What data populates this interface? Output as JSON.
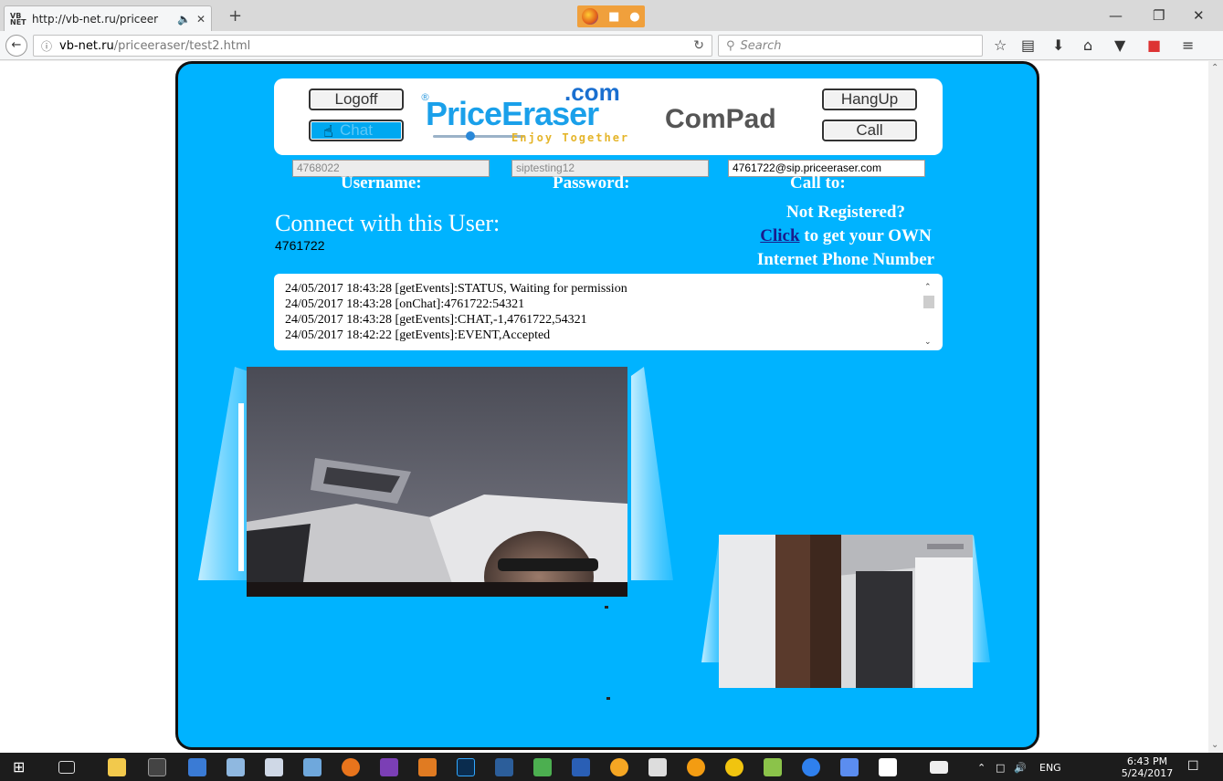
{
  "browser": {
    "tab_favicon_text": "VB NET",
    "tab_title": "http://vb-net.ru/priceer",
    "tab_audio_icon": "speaker-icon",
    "url_domain": "vb-net.ru",
    "url_path": "/priceeraser/test2.html",
    "search_placeholder": "Search"
  },
  "header": {
    "logoff_label": "Logoff",
    "chat_label": "Chat",
    "hangup_label": "HangUp",
    "call_label": "Call",
    "logo_com": ".com",
    "logo_reg": "®",
    "logo_brand": "PriceEraser",
    "logo_tagline": "Enjoy Together",
    "compad": "ComPad"
  },
  "form": {
    "username_value": "4768022",
    "password_value": "siptesting12",
    "callto_value": "4761722@sip.priceeraser.com",
    "username_label": "Username:",
    "password_label": "Password:",
    "callto_label": "Call to:"
  },
  "connect": {
    "title": "Connect with this User:",
    "user_id": "4761722"
  },
  "register": {
    "line1": "Not Registered?",
    "link": "Click",
    "line2_rest": " to get your OWN",
    "line3": "Internet Phone Number"
  },
  "log": {
    "lines": [
      "24/05/2017 18:43:28 [getEvents]:STATUS, Waiting for permission",
      "24/05/2017 18:43:28 [onChat]:4761722:54321",
      "24/05/2017 18:43:28 [getEvents]:CHAT,-1,4761722,54321",
      "24/05/2017 18:42:22 [getEvents]:EVENT,Accepted"
    ]
  },
  "taskbar": {
    "time": "6:43 PM",
    "date": "5/24/2017",
    "lang": "ENG"
  },
  "colors": {
    "panel_bg": "#00b3ff",
    "brand_blue": "#1aa0ea",
    "tagline_gold": "#e5b52a"
  }
}
